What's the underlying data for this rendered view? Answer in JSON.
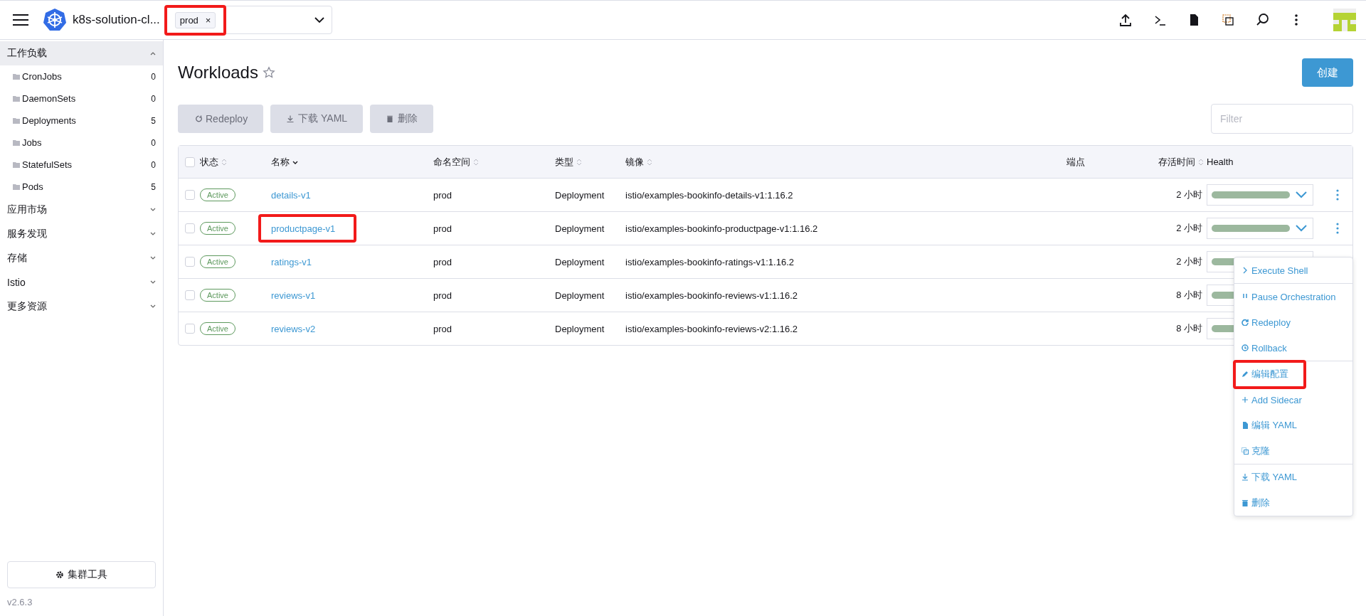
{
  "header": {
    "cluster_name": "k8s-solution-cl...",
    "namespace_filter": {
      "chips": [
        {
          "label": "prod",
          "remove": "×",
          "highlighted": true
        }
      ]
    }
  },
  "sidebar": {
    "groups": [
      {
        "label": "工作负载",
        "expanded": true,
        "children": [
          {
            "label": "CronJobs",
            "count": "0"
          },
          {
            "label": "DaemonSets",
            "count": "0"
          },
          {
            "label": "Deployments",
            "count": "5"
          },
          {
            "label": "Jobs",
            "count": "0"
          },
          {
            "label": "StatefulSets",
            "count": "0"
          },
          {
            "label": "Pods",
            "count": "5"
          }
        ]
      },
      {
        "label": "应用市场",
        "expanded": false
      },
      {
        "label": "服务发现",
        "expanded": false
      },
      {
        "label": "存储",
        "expanded": false
      },
      {
        "label": "Istio",
        "expanded": false
      },
      {
        "label": "更多资源",
        "expanded": false
      }
    ],
    "cluster_tools_button": "集群工具",
    "version": "v2.6.3"
  },
  "page": {
    "title": "Workloads",
    "create_button": "创建",
    "bulk_actions": [
      "Redeploy",
      "下载 YAML",
      "删除"
    ],
    "filter": {
      "placeholder": "Filter"
    }
  },
  "table": {
    "select_all": {
      "selected": false
    },
    "columns": [
      {
        "label": "状态",
        "sortable": true,
        "sorted": false
      },
      {
        "label": "名称",
        "sortable": true,
        "sorted": true
      },
      {
        "label": "命名空间",
        "sortable": true,
        "sorted": false
      },
      {
        "label": "类型",
        "sortable": true,
        "sorted": false
      },
      {
        "label": "镜像",
        "sortable": true,
        "sorted": false
      },
      {
        "label": "端点",
        "sortable": false
      },
      {
        "label": "存活时间",
        "sortable": true,
        "sorted": false
      },
      {
        "label": "Health",
        "sortable": false
      }
    ],
    "rows": [
      {
        "selected": false,
        "state": "Active",
        "name": "details-v1",
        "highlighted": false,
        "namespace": "prod",
        "type": "Deployment",
        "image": "istio/examples-bookinfo-details-v1:1.16.2",
        "age": "2 小时",
        "health": {
          "level": 1
        }
      },
      {
        "selected": false,
        "state": "Active",
        "name": "productpage-v1",
        "highlighted": true,
        "namespace": "prod",
        "type": "Deployment",
        "image": "istio/examples-bookinfo-productpage-v1:1.16.2",
        "age": "2 小时",
        "health": {
          "level": 1
        }
      },
      {
        "selected": false,
        "state": "Active",
        "name": "ratings-v1",
        "highlighted": false,
        "namespace": "prod",
        "type": "Deployment",
        "image": "istio/examples-bookinfo-ratings-v1:1.16.2",
        "age": "2 小时",
        "health": {
          "level": 1
        }
      },
      {
        "selected": false,
        "state": "Active",
        "name": "reviews-v1",
        "highlighted": false,
        "namespace": "prod",
        "type": "Deployment",
        "image": "istio/examples-bookinfo-reviews-v1:1.16.2",
        "age": "8 小时",
        "health": {
          "level": 1
        }
      },
      {
        "selected": false,
        "state": "Active",
        "name": "reviews-v2",
        "highlighted": false,
        "namespace": "prod",
        "type": "Deployment",
        "image": "istio/examples-bookinfo-reviews-v2:1.16.2",
        "age": "8 小时",
        "health": {
          "level": 1
        }
      }
    ]
  },
  "action_menu": {
    "groups": [
      [
        {
          "label": "Execute Shell",
          "highlighted": false
        }
      ],
      [
        {
          "label": "Pause Orchestration",
          "highlighted": false
        },
        {
          "label": "Redeploy",
          "highlighted": false
        },
        {
          "label": "Rollback",
          "highlighted": false
        }
      ],
      [
        {
          "label": "编辑配置",
          "highlighted": true
        },
        {
          "label": "Add Sidecar",
          "highlighted": false
        },
        {
          "label": "编辑 YAML",
          "highlighted": false
        },
        {
          "label": "克隆",
          "highlighted": false
        }
      ],
      [
        {
          "label": "下载 YAML",
          "highlighted": false
        },
        {
          "label": "删除",
          "highlighted": false
        }
      ]
    ]
  }
}
